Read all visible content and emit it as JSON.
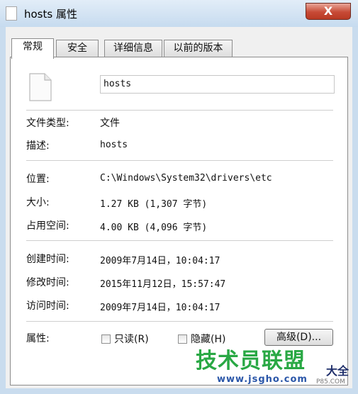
{
  "window": {
    "title": "hosts 属性",
    "close_glyph": "X"
  },
  "tabs": [
    {
      "label": "常规",
      "active": true
    },
    {
      "label": "安全",
      "active": false
    },
    {
      "label": "详细信息",
      "active": false
    },
    {
      "label": "以前的版本",
      "active": false
    }
  ],
  "general": {
    "file_name": "hosts",
    "type_label": "文件类型:",
    "type_value": "文件",
    "desc_label": "描述:",
    "desc_value": "hosts",
    "location_label": "位置:",
    "location_value": "C:\\Windows\\System32\\drivers\\etc",
    "size_label": "大小:",
    "size_value": "1.27 KB (1,307 字节)",
    "disk_label": "占用空间:",
    "disk_value": "4.00 KB (4,096 字节)",
    "created_label": "创建时间:",
    "created_value": "2009年7月14日，10:04:17",
    "modified_label": "修改时间:",
    "modified_value": "2015年11月12日，15:57:47",
    "accessed_label": "访问时间:",
    "accessed_value": "2009年7月14日，10:04:17",
    "attr_label": "属性:",
    "readonly_label": "只读(R)",
    "hidden_label": "隐藏(H)",
    "advanced_label": "高级(D)..."
  },
  "watermark": {
    "main": "技术员联盟",
    "side": "大全",
    "url": "www.jsgho.com",
    "url2": "P85.COM"
  }
}
